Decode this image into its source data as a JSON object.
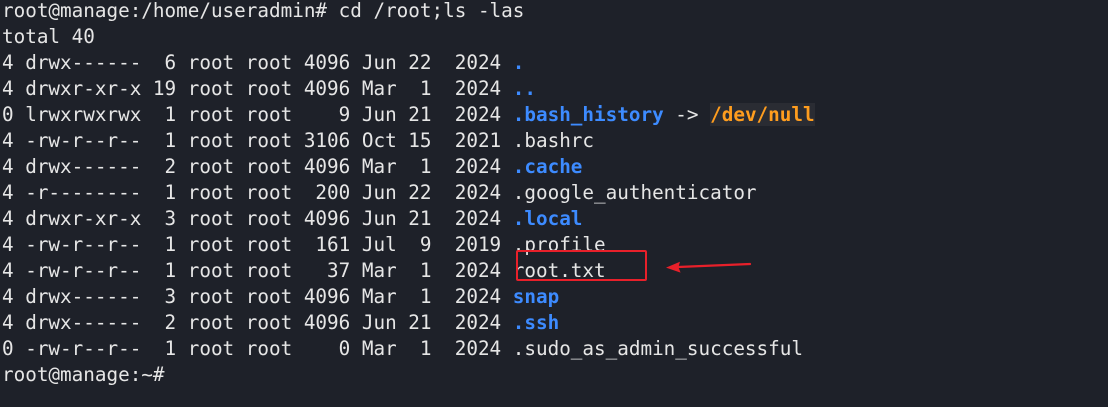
{
  "terminal": {
    "prompt_line": "root@manage:/home/useradmin# cd /root;ls -las",
    "total_line": "total 40",
    "rows": [
      {
        "meta": "4 drwx------  6 root root 4096 Jun 22  2024 ",
        "name": ".",
        "kind": "dir"
      },
      {
        "meta": "4 drwxr-xr-x 19 root root 4096 Mar  1  2024 ",
        "name": "..",
        "kind": "dir"
      },
      {
        "meta": "0 lrwxrwxrwx  1 root root    9 Jun 21  2024 ",
        "name": ".bash_history",
        "kind": "link",
        "arrow": " -> ",
        "target": "/dev/null"
      },
      {
        "meta": "4 -rw-r--r--  1 root root 3106 Oct 15  2021 ",
        "name": ".bashrc",
        "kind": "file"
      },
      {
        "meta": "4 drwx------  2 root root 4096 Mar  1  2024 ",
        "name": ".cache",
        "kind": "dir"
      },
      {
        "meta": "4 -r--------  1 root root  200 Jun 22  2024 ",
        "name": ".google_authenticator",
        "kind": "file"
      },
      {
        "meta": "4 drwxr-xr-x  3 root root 4096 Jun 21  2024 ",
        "name": ".local",
        "kind": "dir"
      },
      {
        "meta": "4 -rw-r--r--  1 root root  161 Jul  9  2019 ",
        "name": ".profile",
        "kind": "file"
      },
      {
        "meta": "4 -rw-r--r--  1 root root   37 Mar  1  2024 ",
        "name": "root.txt",
        "kind": "file"
      },
      {
        "meta": "4 drwx------  3 root root 4096 Mar  1  2024 ",
        "name": "snap",
        "kind": "dir"
      },
      {
        "meta": "4 drwx------  2 root root 4096 Jun 21  2024 ",
        "name": ".ssh",
        "kind": "dir"
      },
      {
        "meta": "0 -rw-r--r--  1 root root    0 Mar  1  2024 ",
        "name": ".sudo_as_admin_successful",
        "kind": "file"
      }
    ],
    "final_prompt": "root@manage:~# "
  },
  "colors": {
    "background": "#1e2129",
    "text": "#e6e6e6",
    "directory": "#3d8bff",
    "symlink_target": "#ff9d1e",
    "annotation": "#e8202a"
  },
  "annotation": {
    "highlighted_item": "root.txt",
    "icon": "arrow-left-icon"
  }
}
